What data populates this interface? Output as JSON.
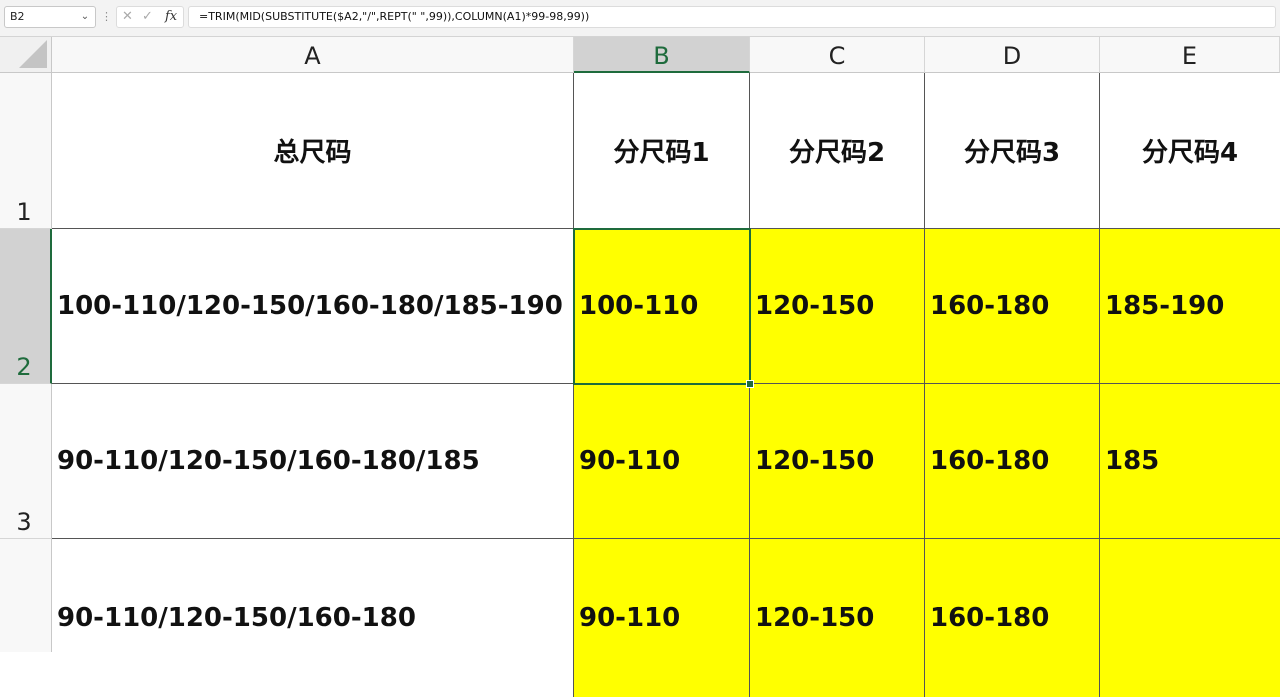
{
  "formula_bar": {
    "name_box": "B2",
    "formula": "=TRIM(MID(SUBSTITUTE($A2,\"/\",REPT(\" \",99)),COLUMN(A1)*99-98,99))"
  },
  "columns": [
    "A",
    "B",
    "C",
    "D",
    "E"
  ],
  "rows": [
    "1",
    "2",
    "3"
  ],
  "cells": {
    "A1": "总尺码",
    "B1": "分尺码1",
    "C1": "分尺码2",
    "D1": "分尺码3",
    "E1": "分尺码4",
    "A2": "100-110/120-150/160-180/185-190",
    "B2": "100-110",
    "C2": "120-150",
    "D2": "160-180",
    "E2": "185-190",
    "A3": "90-110/120-150/160-180/185",
    "B3": "90-110",
    "C3": "120-150",
    "D3": "160-180",
    "E3": "185",
    "A4": "90-110/120-150/160-180",
    "B4": "90-110",
    "C4": "120-150",
    "D4": "160-180",
    "E4": ""
  },
  "colors": {
    "highlight": "#ffff00",
    "selection": "#1e6b3c"
  }
}
